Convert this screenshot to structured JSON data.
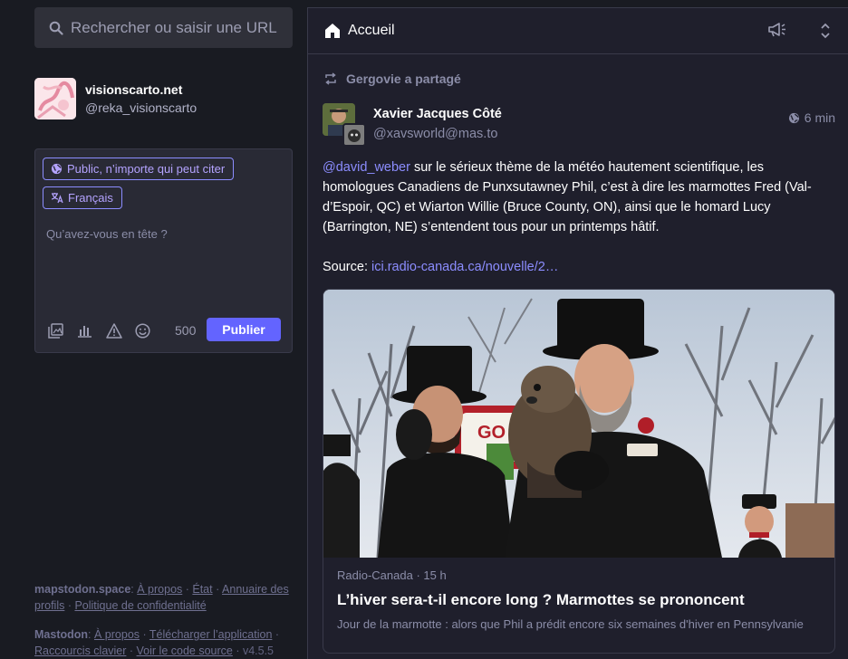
{
  "search": {
    "placeholder": "Rechercher ou saisir une URL"
  },
  "account": {
    "display_name": "visionscarto.net",
    "handle": "@reka_visionscarto"
  },
  "compose": {
    "visibility_label": "Public, n’importe qui peut citer",
    "language_label": "Français",
    "placeholder": "Qu’avez-vous en tête ?",
    "char_count": "500",
    "publish_label": "Publier"
  },
  "footer": {
    "server_name": "mapstodon.space",
    "server_links": [
      "À propos",
      "État",
      "Annuaire des profils",
      "Politique de confidentialité"
    ],
    "app_name": "Mastodon",
    "app_links": [
      "À propos",
      "Télécharger l’application",
      "Raccourcis clavier",
      "Voir le code source"
    ],
    "version": "v4.5.5"
  },
  "header": {
    "title": "Accueil"
  },
  "status": {
    "boosted_by": "Gergovie a partagé",
    "author_name": "Xavier Jacques Côté",
    "author_handle": "@xavsworld@mas.to",
    "time": "6 min",
    "mention": "@david_weber",
    "body": " sur le sérieux thème de la météo hautement scientifique, les homologues Canadiens de Punxsutawney Phil, c’est à dire les marmottes Fred (Val-d’Espoir, QC) et Wiarton Willie (Bruce County, ON), ainsi que le homard Lucy (Barrington, NE) s’entendent tous pour un printemps hâtif.",
    "source_label": "Source: ",
    "source_link": "ici.radio-canada.ca/nouvelle/2…"
  },
  "card": {
    "publisher": "Radio-Canada",
    "age": "15 h",
    "title": "L’hiver sera-t-il encore long ? Marmottes se prononcent",
    "description": "Jour de la marmotte : alors que Phil a prédit encore six semaines d'hiver en Pennsylvanie",
    "sign_text": "GO"
  },
  "colors": {
    "accent": "#6364ff",
    "link": "#8c8dff",
    "background": "#191b22",
    "panel": "#1f1f2c"
  }
}
